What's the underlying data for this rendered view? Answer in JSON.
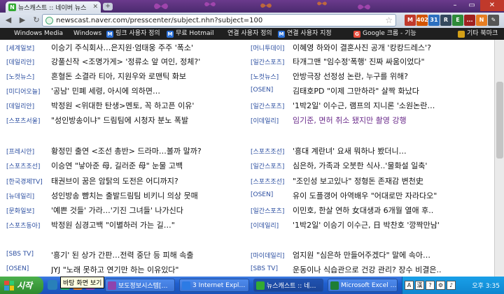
{
  "browser": {
    "tab_title": "뉴스캐스트 :: 네이버 뉴스",
    "tab_favicon": "N",
    "url": "newscast.naver.com/presscenter/subject.nhn?subject=100",
    "extensions": [
      {
        "name": "gmail-icon",
        "label": "M",
        "color": "#c0392b"
      },
      {
        "name": "badge-icon",
        "label": "402",
        "color": "#d35400"
      },
      {
        "name": "calendar-icon",
        "label": "31",
        "color": "#2c6fbf"
      },
      {
        "name": "reader-icon",
        "label": "R",
        "color": "#34495e"
      },
      {
        "name": "evernote-icon",
        "label": "E",
        "color": "#2e8b3a"
      },
      {
        "name": "lastpass-icon",
        "label": "...",
        "color": "#a02020"
      },
      {
        "name": "note-icon",
        "label": "N",
        "color": "#e67e22"
      },
      {
        "name": "wrench-icon",
        "label": "✎",
        "color": "#555"
      }
    ]
  },
  "bookmarks": {
    "items": [
      {
        "label": "Windows Media",
        "icon": ""
      },
      {
        "label": "Windows",
        "icon": ""
      },
      {
        "label": "링크 사용자 정의",
        "icon": "M"
      },
      {
        "label": "무료 Hotmail",
        "icon": "M"
      },
      {
        "label": "연결 사용자 정의",
        "icon": ""
      },
      {
        "label": "연결 사용자 지정",
        "icon": "M"
      },
      {
        "label": "Google 크롬 - 기능",
        "icon": "G"
      }
    ],
    "other": "기타 북마크"
  },
  "news": {
    "left": [
      {
        "source": "[세계일보]",
        "headline": "이승기 주식회사…은지원·엄태웅 주주 '폭소'"
      },
      {
        "source": "[데일리안]",
        "headline": "강풀신작 <조명가게> '정류소 앞 여인, 정체?'"
      },
      {
        "source": "[노컷뉴스]",
        "headline": "혼혈돈 소결라 티아, 지원우와 로맨틱 화보"
      },
      {
        "source": "[미디어오늘]",
        "headline": "'공남' 민폐 세령, 아시에 의하면…"
      },
      {
        "source": "[데일리안]",
        "headline": "박정원 <위대한 탄생>멘토, 꼭 하고픈 이유'"
      },
      {
        "source": "[스포츠서울]",
        "headline": "\"성인방송이냐\" 드림팀에 시청자 분노 폭발"
      },
      {
        "source": "[프레시안]",
        "headline": "황정민 출연 <조선 총반> 드라마…볼까 말까?"
      },
      {
        "source": "[스포츠조선]",
        "headline": "이승연 \"낳아준 母, 길러준 母\" 눈물 고백"
      },
      {
        "source": "[한국경제TV]",
        "headline": "태권브이 꿈은 암탉의 도전은 어디까지?"
      },
      {
        "source": "[뉴데일리]",
        "headline": "성인방송 뺨치는 출발드림팀 비키니 의상 뭇매"
      },
      {
        "source": "[문화일보]",
        "headline": "'예쁜 것들' 가라…'기진 그녀들' 나가신다"
      },
      {
        "source": "[스포츠동아]",
        "headline": "박정원 심경고백 \"이별하러 가는 길…\""
      },
      {
        "source": "[SBS TV]",
        "headline": "'흥기' 된 상가 간판…전력 중단 등 피해 속출"
      },
      {
        "source": "[OSEN]",
        "headline": "JYJ \"노래 못하고 연기만 하는 이유있다\""
      }
    ],
    "right": [
      {
        "source": "[머니투데이]",
        "headline": "이혜영 하와이 결혼사진 공개 '캉캉드레스'?",
        "purple": false
      },
      {
        "source": "[일간스포츠]",
        "headline": "타개그맨 \"임수정'폭행' 진짜 싸움이었다\"",
        "purple": false
      },
      {
        "source": "[노컷뉴스]",
        "headline": "안방극장 선정성 논란, 누구를 위해?",
        "purple": false
      },
      {
        "source": "[OSEN]",
        "headline": "김태호PD \"이제 그만하라\" 살짝 화났다",
        "purple": false
      },
      {
        "source": "[일간스포츠]",
        "headline": "'1박2일' 이수근, 램프의 지니론 '소원논란…",
        "purple": false
      },
      {
        "source": "[이데일리]",
        "headline": "임기준, 면허 취소 됐지만 촬영 강행",
        "purple": true
      },
      {
        "source": "[스포츠조선]",
        "headline": "'흥대 계란녀' 요새 뭐하나 봤더니…",
        "purple": false
      },
      {
        "source": "[일간스포츠]",
        "headline": "심은하, 가족과 오붓한 식사..'물화설 일축'",
        "purple": false
      },
      {
        "source": "[스포츠조선]",
        "headline": "\"조인성 보고있나\" 정형돈 존재감 변천史",
        "purple": false
      },
      {
        "source": "[OSEN]",
        "headline": "유이 도플갱어 아역배우 \"어대로만 자라다오\"",
        "purple": false
      },
      {
        "source": "[일간스포츠]",
        "headline": "이민호, 한살 연하 女대생과 6개월 열애 후..",
        "purple": false
      },
      {
        "source": "[이데일리]",
        "headline": "'1박2일' 이승기 이수근, 日 박찬호 '깡짝만남'",
        "purple": false
      },
      {
        "source": "[마이데일리]",
        "headline": "엄지원 \"심은하 만들어주겠다\" 말에 속아…",
        "purple": false
      },
      {
        "source": "[SBS TV]",
        "headline": "운동이나 식습관으로 건강 관리? 장수 비결은..",
        "purple": false
      }
    ]
  },
  "taskbar": {
    "start_label": "시작",
    "tooltip": "바탕 화면 보기",
    "tasks": [
      {
        "label": "보도정보시스템[…",
        "color": "#8e44ad"
      },
      {
        "label": "3 Internet Expl…",
        "color": "#2c7be5"
      },
      {
        "label": "뉴스캐스트 :: 네…",
        "color": "#3a3"
      },
      {
        "label": "Microsoft Excel …",
        "color": "#1e7e34"
      }
    ],
    "tray": {
      "lang": "A",
      "ime": "漢",
      "clock": "오후 3:35"
    }
  }
}
